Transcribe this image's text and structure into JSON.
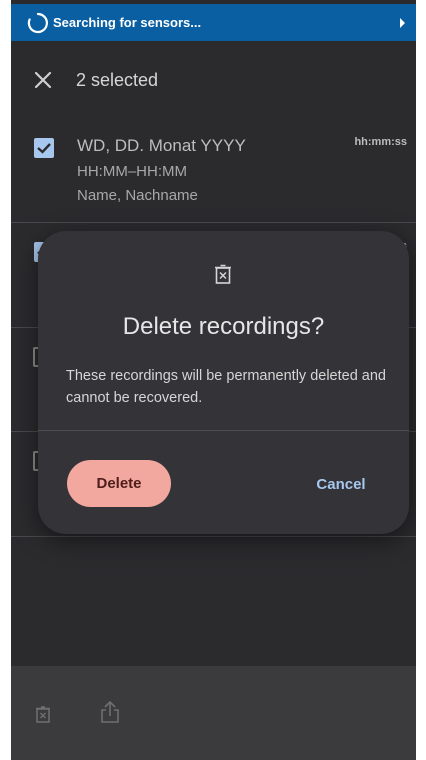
{
  "status_bar": {
    "text": "Searching for sensors...",
    "icon_spinner": "loading-spinner-icon",
    "icon_arrow": "chevron-right-icon"
  },
  "appbar": {
    "title": "2 selected",
    "close_icon": "close-icon"
  },
  "list": {
    "items": [
      {
        "date": "WD, DD. Monat YYYY",
        "time_range": "HH:MM–HH:MM",
        "name": "Name, Nachname",
        "duration": "hh:mm:ss",
        "checked": true
      },
      {
        "date": "",
        "time_range": "",
        "name": "",
        "duration": "s",
        "checked": true
      },
      {
        "date": "",
        "time_range": "",
        "name": "",
        "duration": "",
        "checked": false
      },
      {
        "date": "",
        "time_range": "",
        "name": "",
        "duration": "",
        "checked": false
      }
    ]
  },
  "dialog": {
    "icon": "delete-icon",
    "title": "Delete recordings?",
    "message": "These recordings will be permanently deleted and cannot be recovered.",
    "delete_label": "Delete",
    "cancel_label": "Cancel"
  },
  "bottom_bar": {
    "delete_icon": "delete-icon",
    "share_icon": "share-icon"
  },
  "colors": {
    "status_bar": "#0a5fa3",
    "background": "#2b2b2e",
    "dialog": "#333338",
    "delete_button": "#f2a79f",
    "accent": "#a8c7ee"
  }
}
